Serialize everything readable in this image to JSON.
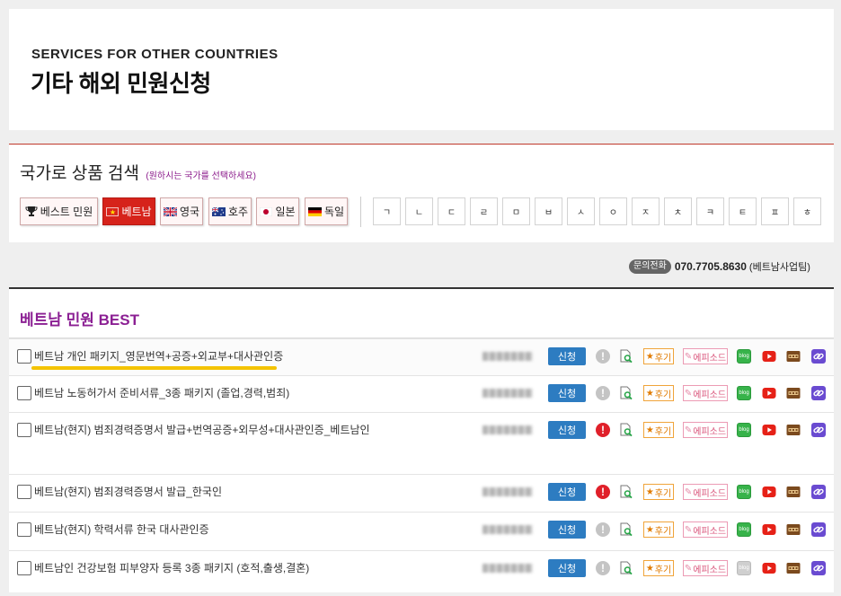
{
  "header": {
    "eng_title": "SERVICES FOR OTHER COUNTRIES",
    "kor_title": "기타 해외 민원신청"
  },
  "search": {
    "title": "국가로 상품 검색",
    "hint": "(원하시는 국가를 선택하세요)",
    "countries": [
      {
        "label": "베스트 민원",
        "icon": "trophy-icon",
        "active": false
      },
      {
        "label": "베트남",
        "icon": "vietnam-flag-icon",
        "active": true
      },
      {
        "label": "영국",
        "icon": "uk-flag-icon",
        "active": false
      },
      {
        "label": "호주",
        "icon": "australia-flag-icon",
        "active": false
      },
      {
        "label": "일본",
        "icon": "japan-flag-icon",
        "active": false
      },
      {
        "label": "독일",
        "icon": "germany-flag-icon",
        "active": false
      }
    ],
    "consonants": [
      "ㄱ",
      "ㄴ",
      "ㄷ",
      "ㄹ",
      "ㅁ",
      "ㅂ",
      "ㅅ",
      "ㅇ",
      "ㅈ",
      "ㅊ",
      "ㅋ",
      "ㅌ",
      "ㅍ",
      "ㅎ"
    ]
  },
  "contact": {
    "badge": "문의전화",
    "phone": "070.7705.8630",
    "team": "(베트남사업팀)"
  },
  "section": {
    "title": "베트남 민원 BEST"
  },
  "row_labels": {
    "apply": "신청",
    "review": "후기",
    "episode": "에피소드",
    "blog": "blog"
  },
  "rows": [
    {
      "title": "베트남 개인 패키지_영문번역+공증+외교부+대사관인증",
      "alert": "gray",
      "blog_active": true,
      "highlighted": true
    },
    {
      "title": "베트남 노동허가서 준비서류_3종 패키지 (졸업,경력,범죄)",
      "alert": "gray",
      "blog_active": true,
      "highlighted": false
    },
    {
      "title": "베트남(현지) 범죄경력증명서 발급+번역공증+외무성+대사관인증_베트남인",
      "alert": "red",
      "blog_active": true,
      "highlighted": false
    },
    {
      "title": "베트남(현지) 범죄경력증명서 발급_한국인",
      "alert": "red",
      "blog_active": true,
      "highlighted": false
    },
    {
      "title": "베트남(현지) 학력서류 한국 대사관인증",
      "alert": "gray",
      "blog_active": true,
      "highlighted": false
    },
    {
      "title": "베트남인 건강보험 피부양자 등록 3종 패키지 (호적,출생,결혼)",
      "alert": "gray",
      "blog_active": false,
      "highlighted": false
    }
  ],
  "colors": {
    "accent_red": "#d6231b",
    "apply_blue": "#2d7cc1",
    "section_purple": "#8b1f93",
    "highlight_yellow": "#f4c300"
  }
}
